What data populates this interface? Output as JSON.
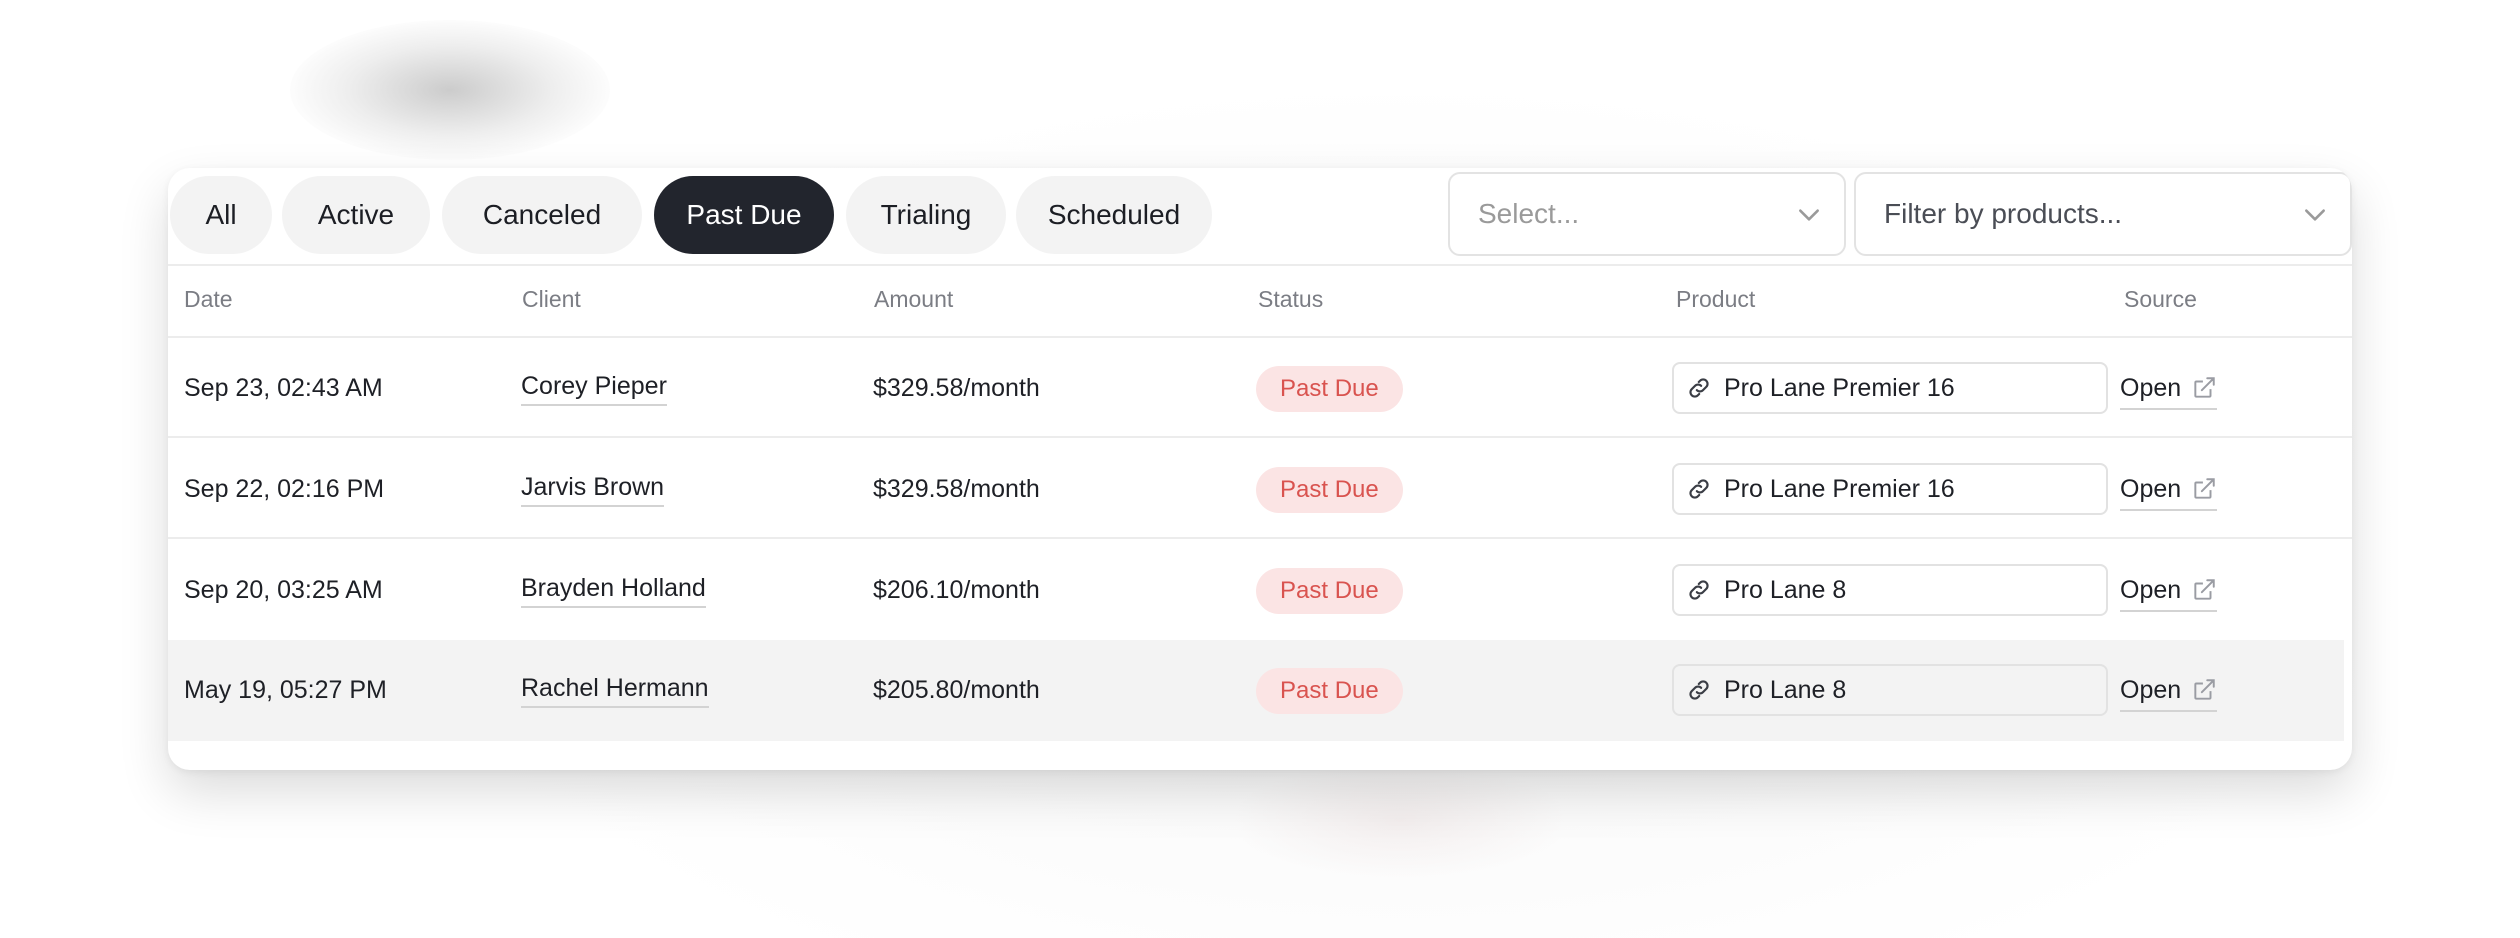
{
  "filters": {
    "tabs": [
      {
        "label": "All",
        "active": false
      },
      {
        "label": "Active",
        "active": false
      },
      {
        "label": "Canceled",
        "active": false
      },
      {
        "label": "Past Due",
        "active": true
      },
      {
        "label": "Trialing",
        "active": false
      },
      {
        "label": "Scheduled",
        "active": false
      }
    ],
    "select_placeholder": "Select...",
    "products_placeholder": "Filter by products..."
  },
  "table": {
    "columns": [
      "Date",
      "Client",
      "Amount",
      "Status",
      "Product",
      "Source"
    ],
    "rows": [
      {
        "date": "Sep 23, 02:43 AM",
        "client": "Corey Pieper",
        "amount": "$329.58/month",
        "status": "Past Due",
        "product": "Pro Lane Premier 16",
        "source": "Open",
        "highlighted": false
      },
      {
        "date": "Sep 22, 02:16 PM",
        "client": "Jarvis Brown",
        "amount": "$329.58/month",
        "status": "Past Due",
        "product": "Pro Lane Premier 16",
        "source": "Open",
        "highlighted": false
      },
      {
        "date": "Sep 20, 03:25 AM",
        "client": "Brayden Holland",
        "amount": "$206.10/month",
        "status": "Past Due",
        "product": "Pro Lane 8",
        "source": "Open",
        "highlighted": false
      },
      {
        "date": "May 19, 05:27 PM",
        "client": "Rachel Hermann",
        "amount": "$205.80/month",
        "status": "Past Due",
        "product": "Pro Lane 8",
        "source": "Open",
        "highlighted": true
      }
    ]
  },
  "icons": {
    "chevron": "chevron-down-icon",
    "product": "link-icon",
    "source": "external-link-icon"
  },
  "colors": {
    "active_tab_bg": "#22252d",
    "status_past_due_text": "#d9534f",
    "status_past_due_bg": "#fbe4e4"
  }
}
